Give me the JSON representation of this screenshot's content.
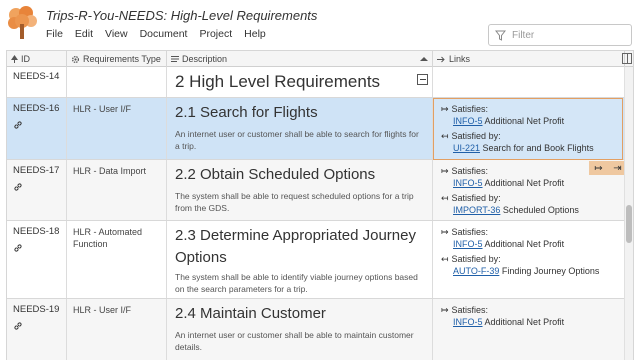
{
  "app": {
    "title": "Trips-R-You-NEEDS: High-Level Requirements"
  },
  "menu": [
    "File",
    "Edit",
    "View",
    "Document",
    "Project",
    "Help"
  ],
  "filter": {
    "placeholder": "Filter"
  },
  "columns": [
    "ID",
    "Requirements Type",
    "Description",
    "Links"
  ],
  "section": {
    "id": "NEEDS-14",
    "title": "2 High Level Requirements"
  },
  "rows": [
    {
      "id": "NEEDS-16",
      "type": "HLR - User I/F",
      "title": "2.1 Search for Flights",
      "description": "An internet user or customer shall be able to search for flights for a trip.",
      "links": [
        {
          "relation": "Satisfies:",
          "key": "INFO-5",
          "name": "Additional Net Profit"
        },
        {
          "relation": "Satisfied by:",
          "key": "UI-221",
          "name": "Search for and Book Flights"
        }
      ]
    },
    {
      "id": "NEEDS-17",
      "type": "HLR - Data Import",
      "title": "2.2 Obtain Scheduled Options",
      "description": "The system shall be able to request scheduled options for a trip from the GDS.",
      "links": [
        {
          "relation": "Satisfies:",
          "key": "INFO-5",
          "name": "Additional Net Profit"
        },
        {
          "relation": "Satisfied by:",
          "key": "IMPORT-36",
          "name": "Scheduled Options"
        }
      ]
    },
    {
      "id": "NEEDS-18",
      "type": "HLR - Automated Function",
      "title": "2.3 Determine Appropriated Journey Options",
      "description": "The system shall be able to identify viable journey options based on the search parameters for a trip.",
      "links": [
        {
          "relation": "Satisfies:",
          "key": "INFO-5",
          "name": "Additional Net Profit"
        },
        {
          "relation": "Satisfied by:",
          "key": "AUTO-F-39",
          "name": "Finding Journey Options"
        }
      ]
    },
    {
      "id": "NEEDS-19",
      "type": "HLR - User I/F",
      "title": "2.4 Maintain Customer",
      "description": "An internet user or customer shall be able to maintain customer details.",
      "links": [
        {
          "relation": "Satisfies:",
          "key": "INFO-5",
          "name": "Additional Net Profit"
        }
      ]
    }
  ],
  "colors": {
    "selected_row": "#cfe3f6",
    "selected_border": "#e39f62",
    "link": "#1f5fa8",
    "action_bar": "#efc8a0"
  },
  "icons": [
    "tree-logo-icon",
    "filter-icon",
    "gear-icon",
    "link-icon",
    "collapse-icon",
    "arrow-right-icon"
  ]
}
